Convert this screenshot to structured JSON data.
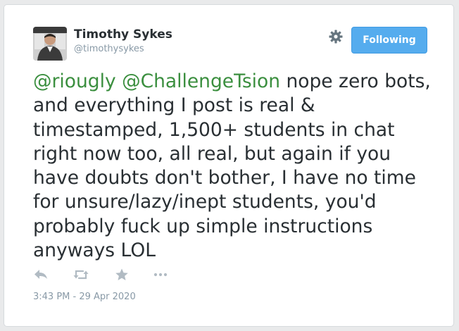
{
  "tweet": {
    "author_name": "Timothy Sykes",
    "author_handle": "@timothysykes",
    "follow_button_label": "Following",
    "text_segments": [
      {
        "type": "mention",
        "text": "@riougly"
      },
      {
        "type": "text",
        "text": " "
      },
      {
        "type": "mention",
        "text": "@ChallengeTsion"
      },
      {
        "type": "text",
        "text": " nope zero bots, and everything I post is real & timestamped, 1,500+ students in chat right now too, all real, but again if you have doubts don't bother, I have no time for unsure/lazy/inept students, you'd probably fuck up simple instructions anyways LOL"
      }
    ],
    "timestamp": "3:43 PM - 29 Apr 2020"
  },
  "icons": {
    "settings": "gear-icon",
    "reply": "reply-icon",
    "retweet": "retweet-icon",
    "favorite": "star-icon",
    "more": "more-icon"
  },
  "colors": {
    "accent": "#55acee",
    "mention": "#3b8f3f",
    "text": "#292f33",
    "muted": "#8899a6",
    "icon": "#b1bbc3"
  }
}
